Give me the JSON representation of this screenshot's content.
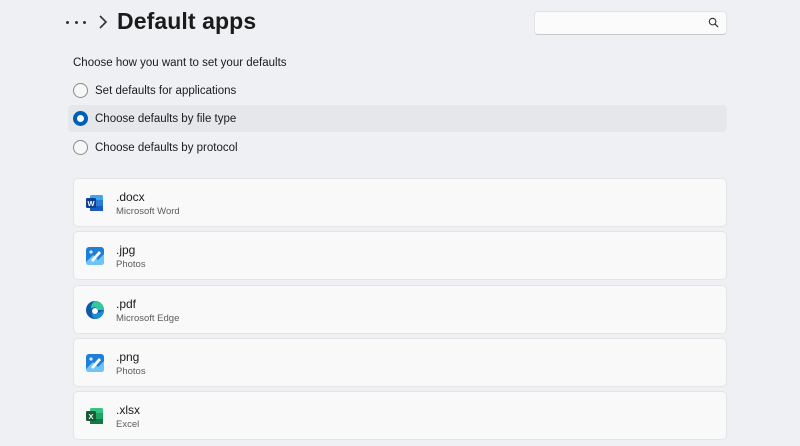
{
  "header": {
    "title": "Default apps",
    "search_placeholder": ""
  },
  "defaults": {
    "prompt": "Choose how you want to set your defaults",
    "options": [
      {
        "label": "Set defaults for applications",
        "selected": false
      },
      {
        "label": "Choose defaults by file type",
        "selected": true
      },
      {
        "label": "Choose defaults by protocol",
        "selected": false
      }
    ]
  },
  "file_types": [
    {
      "extension": ".docx",
      "app": "Microsoft Word",
      "icon": "word-icon"
    },
    {
      "extension": ".jpg",
      "app": "Photos",
      "icon": "photos-icon"
    },
    {
      "extension": ".pdf",
      "app": "Microsoft Edge",
      "icon": "edge-icon"
    },
    {
      "extension": ".png",
      "app": "Photos",
      "icon": "photos-icon"
    },
    {
      "extension": ".xlsx",
      "app": "Excel",
      "icon": "excel-icon"
    }
  ],
  "colors": {
    "accent": "#005fb8",
    "background": "#eef0f3",
    "card": "#f9f9fa"
  }
}
